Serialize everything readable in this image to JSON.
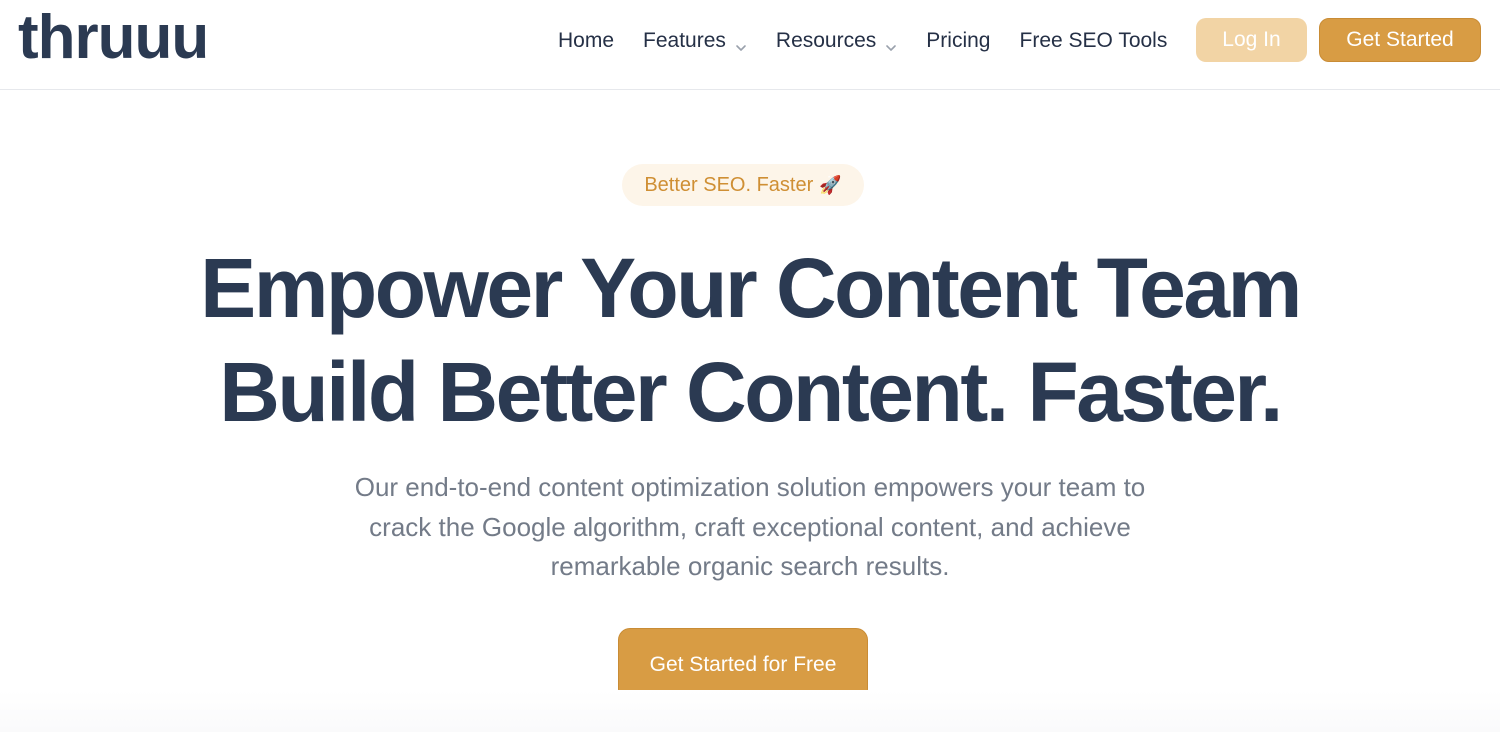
{
  "brand": {
    "logo_text": "thruuu"
  },
  "nav": {
    "items": [
      {
        "label": "Home",
        "has_dropdown": false
      },
      {
        "label": "Features",
        "has_dropdown": true
      },
      {
        "label": "Resources",
        "has_dropdown": true
      },
      {
        "label": "Pricing",
        "has_dropdown": false
      },
      {
        "label": "Free SEO Tools",
        "has_dropdown": false
      }
    ],
    "login_label": "Log In",
    "get_started_label": "Get Started"
  },
  "hero": {
    "badge_text": "Better SEO. Faster",
    "badge_icon": "rocket-icon",
    "headline_line1": "Empower Your Content Team",
    "headline_line2": "Build Better Content. Faster.",
    "subtext_line1": "Our end-to-end content optimization solution empowers your team to",
    "subtext_line2": "crack the Google algorithm, craft exceptional content, and achieve",
    "subtext_line3": "remarkable organic search results.",
    "cta_label": "Get Started for Free"
  },
  "colors": {
    "accent": "#d89c44",
    "accent_light": "#f2d4a5",
    "heading": "#2b3a52",
    "body_text": "#737b88",
    "badge_bg": "#fdf5e9",
    "badge_text": "#cf8f34"
  }
}
